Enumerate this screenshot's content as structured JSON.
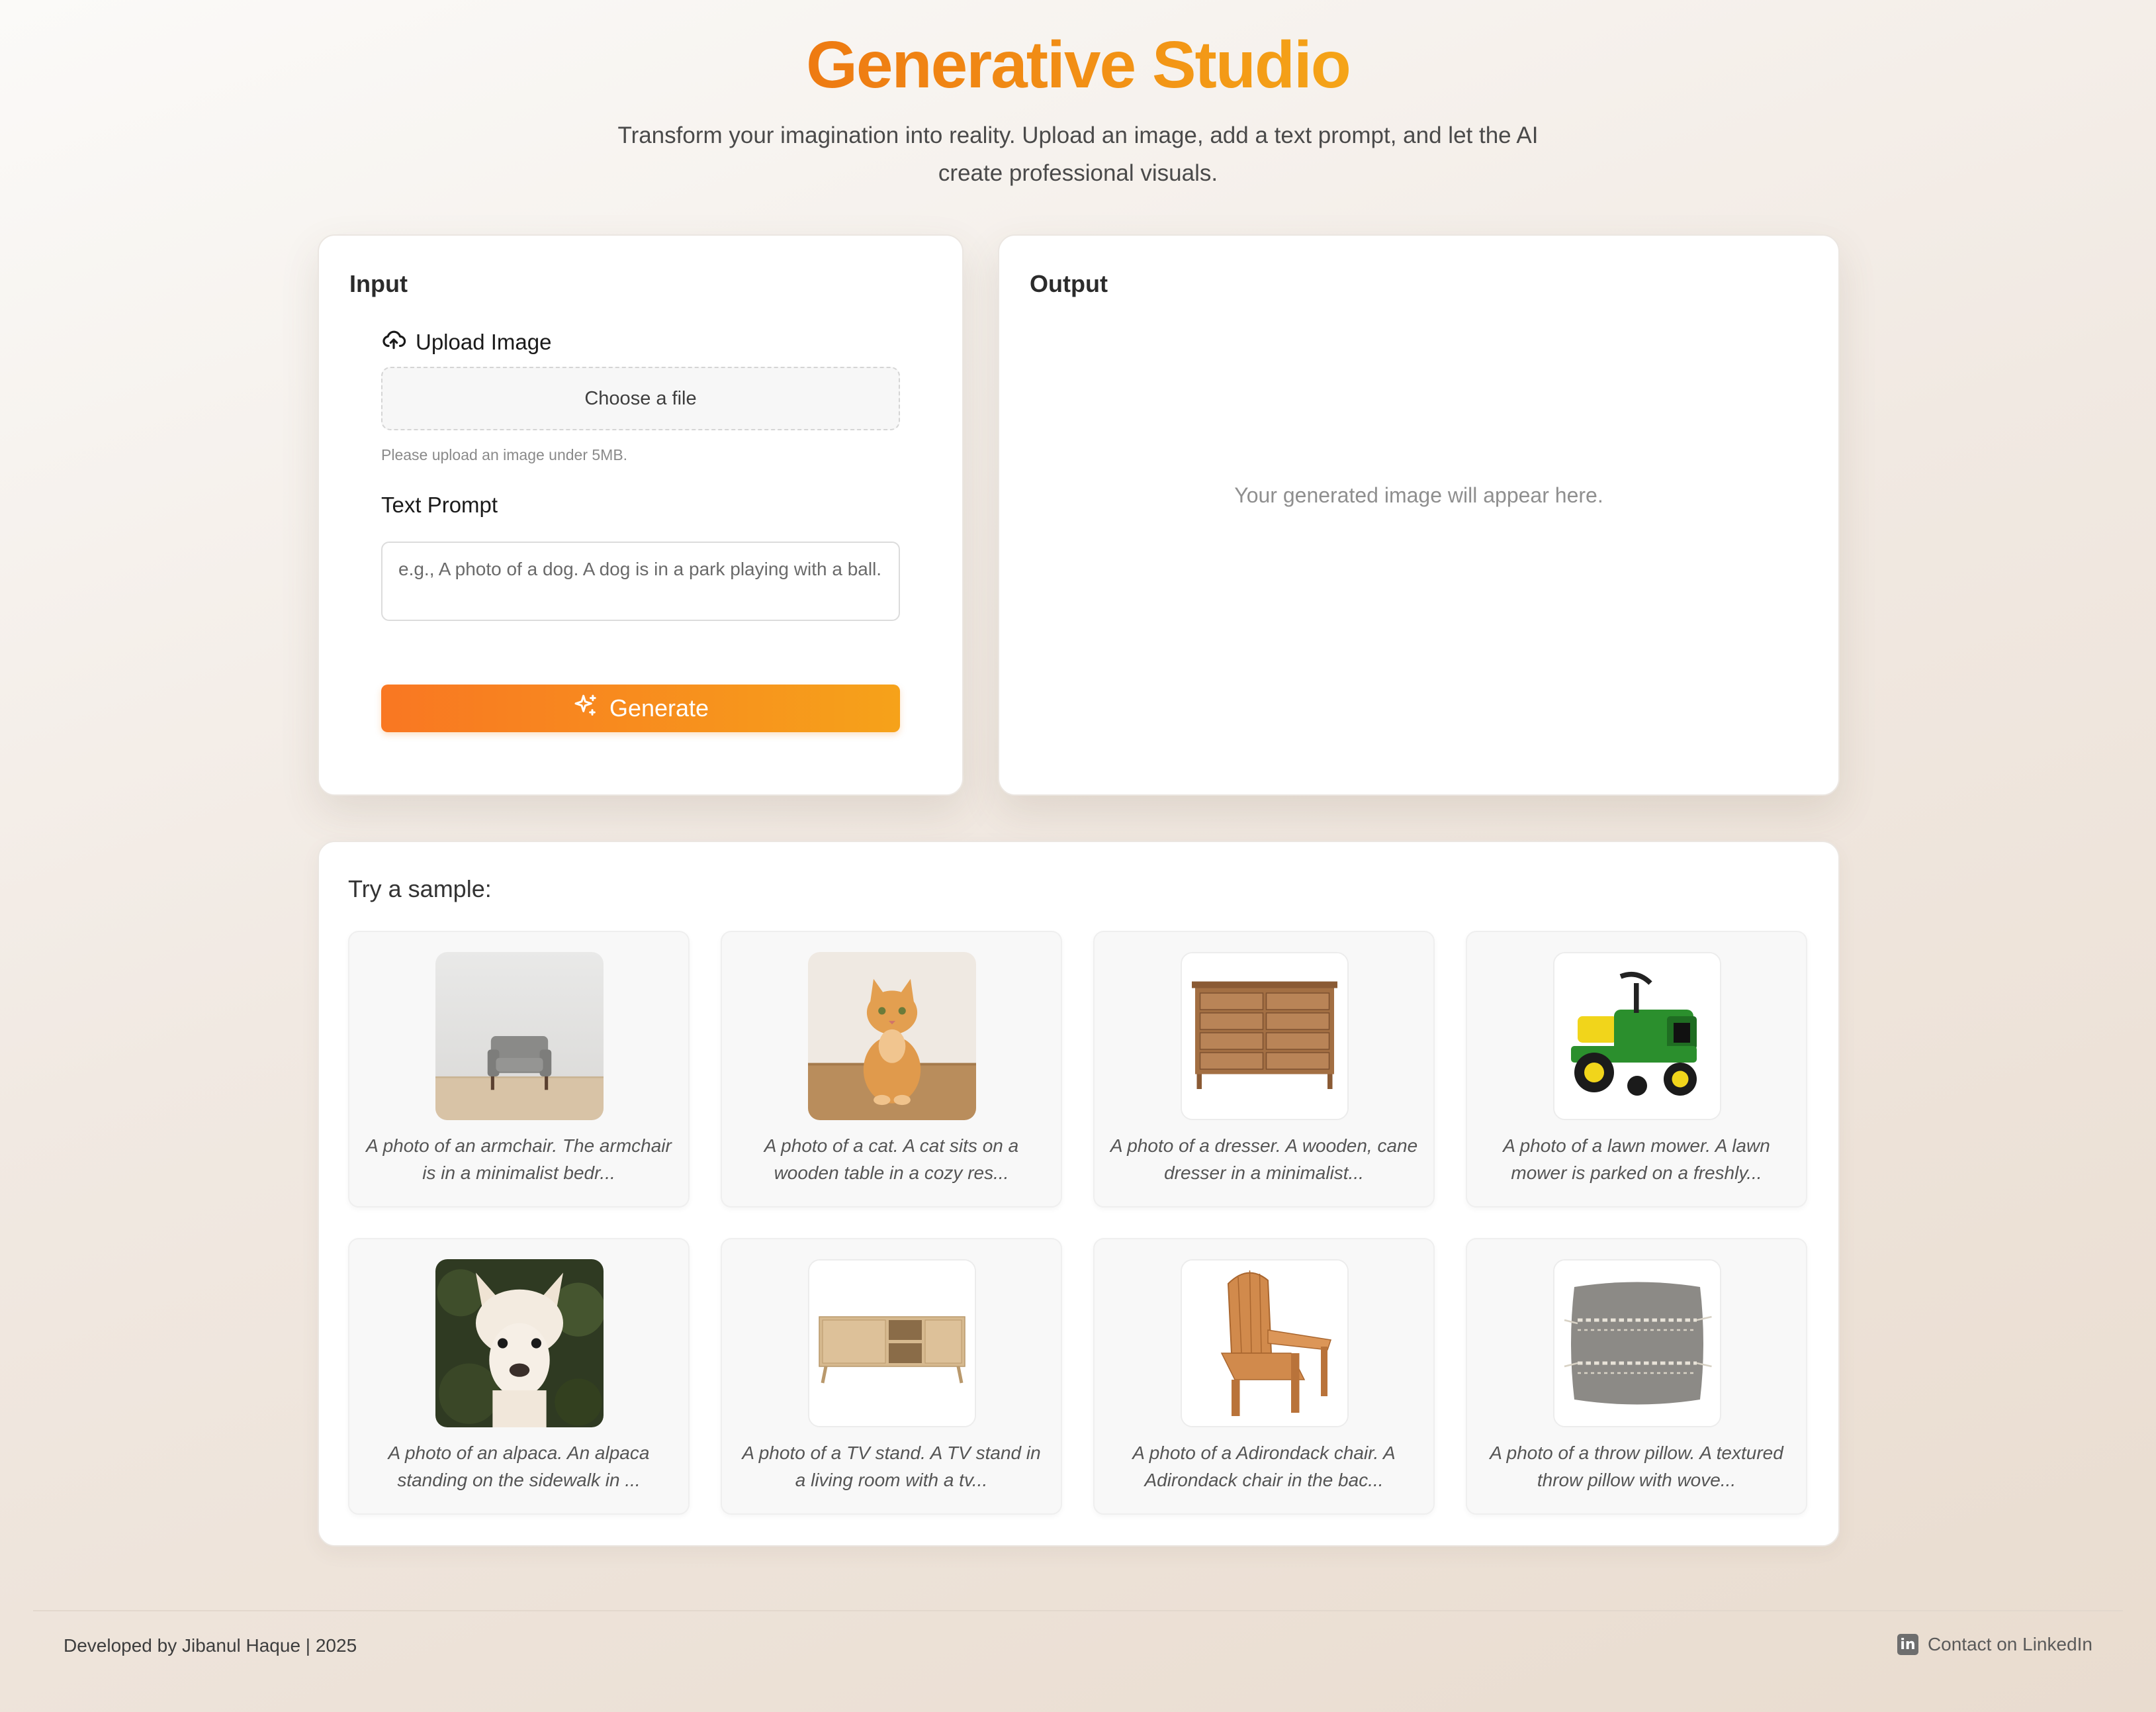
{
  "header": {
    "title": "Generative Studio",
    "subtitle": "Transform your imagination into reality. Upload an image, add a text prompt, and let the AI create professional visuals."
  },
  "input_panel": {
    "heading": "Input",
    "upload_label": "Upload Image",
    "upload_icon": "cloud-upload-icon",
    "file_button": "Choose a file",
    "hint": "Please upload an image under 5MB.",
    "prompt_label": "Text Prompt",
    "prompt_placeholder": "e.g., A photo of a dog. A dog is in a park playing with a ball.",
    "generate_label": "Generate",
    "generate_icon": "sparkles-icon"
  },
  "output_panel": {
    "heading": "Output",
    "placeholder": "Your generated image will appear here."
  },
  "samples": {
    "heading": "Try a sample:",
    "items": [
      {
        "caption": "A photo of an armchair. The armchair is in a minimalist bedr...",
        "image": "armchair"
      },
      {
        "caption": "A photo of a cat. A cat sits on a wooden table in a cozy res...",
        "image": "cat"
      },
      {
        "caption": "A photo of a dresser. A wooden, cane dresser in a minimalist...",
        "image": "dresser"
      },
      {
        "caption": "A photo of a lawn mower. A lawn mower is parked on a freshly...",
        "image": "lawn-mower"
      },
      {
        "caption": "A photo of an alpaca. An alpaca standing on the sidewalk in ...",
        "image": "alpaca"
      },
      {
        "caption": "A photo of a TV stand. A TV stand in a living room with a tv...",
        "image": "tv-stand"
      },
      {
        "caption": "A photo of a Adirondack chair. A Adirondack chair in the bac...",
        "image": "adirondack-chair"
      },
      {
        "caption": "A photo of a throw pillow. A textured throw pillow with wove...",
        "image": "throw-pillow"
      }
    ]
  },
  "footer": {
    "credit": "Developed by Jibanul Haque | 2025",
    "contact_label": "Contact on LinkedIn",
    "contact_icon": "linkedin-icon"
  },
  "colors": {
    "accent_start": "#f97722",
    "accent_end": "#f6a21a",
    "title_start": "#ee7a12",
    "title_end": "#f5a418"
  }
}
